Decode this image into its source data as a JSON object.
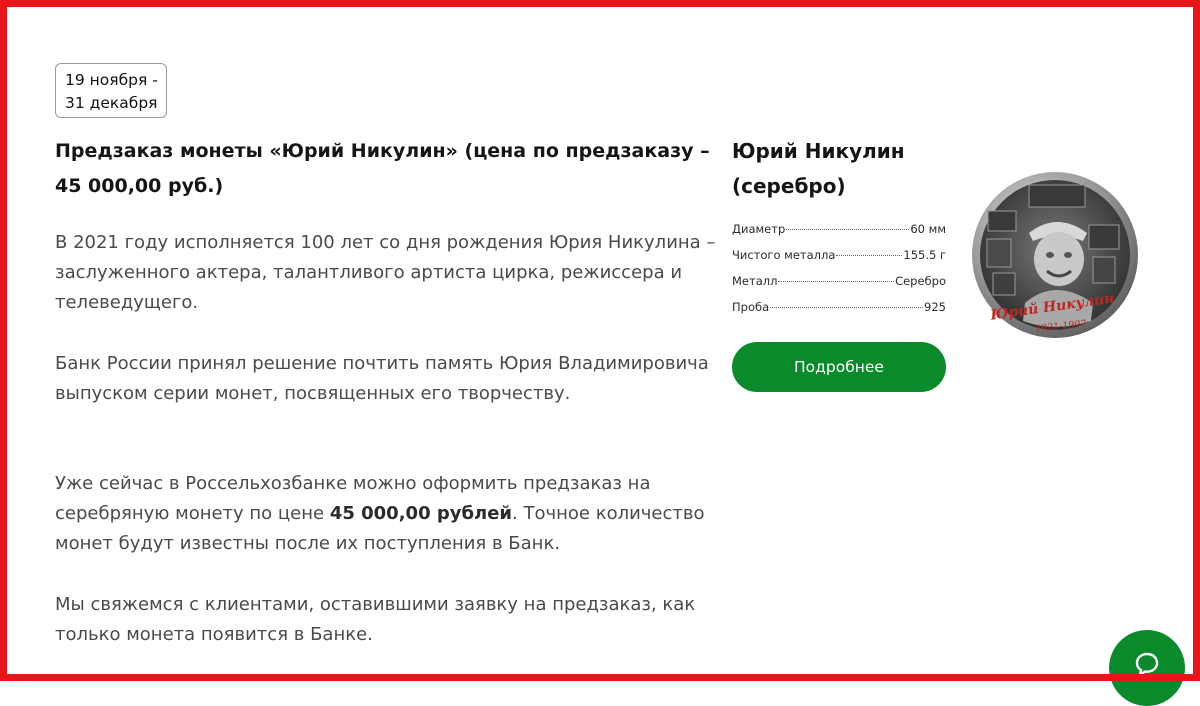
{
  "promo": {
    "date_range": [
      "19 ноября -",
      "31 декабря"
    ],
    "heading_line1": "Предзаказ монеты «Юрий Никулин» (цена по предзаказу –",
    "heading_line2": "45 000,00 руб.)",
    "paragraph1": "В 2021 году исполняется 100 лет со дня рождения Юрия Никулина – заслуженного актера, талантливого артиста цирка, режиссера и телеведущего.",
    "paragraph2": "Банк России принял решение почтить память Юрия Владимировича выпуском серии монет, посвященных его творчеству.",
    "paragraph3_pre": "Уже сейчас в Россельхозбанке можно оформить предзаказ на серебряную монету по цене ",
    "paragraph3_bold": "45 000,00 рублей",
    "paragraph3_post": ". Точное количество монет будут известны после их поступления в Банк.",
    "paragraph4": "Мы свяжемся с клиентами, оставившими заявку на предзаказ, как только монета появится в Банке."
  },
  "coin": {
    "title_line1": "Юрий Никулин",
    "title_line2": "(серебро)",
    "specs": [
      {
        "label": "Диаметр",
        "value": "60 мм"
      },
      {
        "label": "Чистого металла",
        "value": "155.5 г"
      },
      {
        "label": "Металл",
        "value": "Серебро"
      },
      {
        "label": "Проба",
        "value": "925"
      }
    ],
    "more_button": "Подробнее",
    "inscription": "Юрий Никулин",
    "years": "1921-1997"
  },
  "colors": {
    "accent_green": "#0b8a2c",
    "frame_red": "#e8151b"
  },
  "icons": {
    "chat": "chat-bubble-icon"
  }
}
